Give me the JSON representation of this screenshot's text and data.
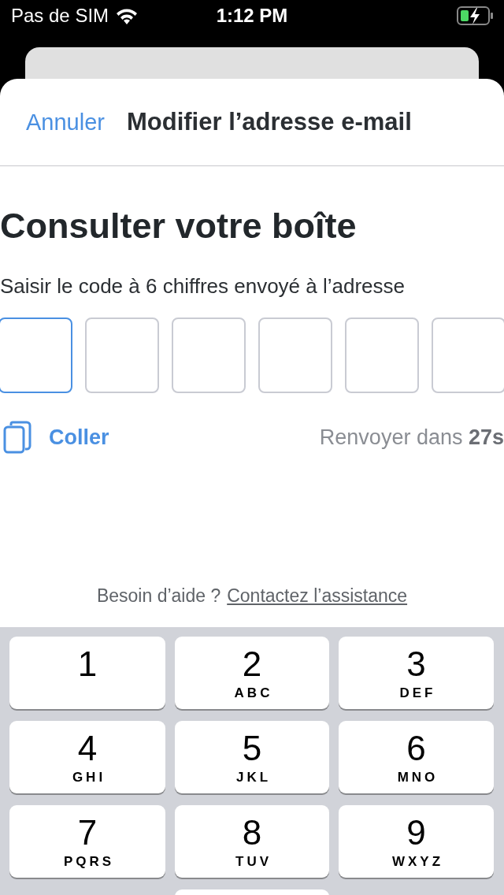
{
  "status_bar": {
    "carrier": "Pas de SIM",
    "time": "1:12 PM"
  },
  "header": {
    "cancel": "Annuler",
    "title": "Modifier l’adresse e-mail"
  },
  "heading": "Consulter votre boîte",
  "instructions": "Saisir le code à 6 chiffres envoyé à l’adresse",
  "code_boxes": [
    {
      "selected": true
    },
    {
      "selected": false
    },
    {
      "selected": false
    },
    {
      "selected": false
    },
    {
      "selected": false
    },
    {
      "selected": false
    }
  ],
  "paste": "Coller",
  "resend": "Renvoyer dans **27s**",
  "help": {
    "text": "Besoin d’aide ?",
    "link": "Contactez l’assistance"
  },
  "keypad": [
    {
      "kind": "digit",
      "digit": "1"
    },
    {
      "kind": "digit",
      "digit": "2",
      "letters": "ABC"
    },
    {
      "kind": "digit",
      "digit": "3",
      "letters": "DEF"
    },
    {
      "kind": "digit",
      "digit": "4",
      "letters": "GHI"
    },
    {
      "kind": "digit",
      "digit": "5",
      "letters": "JKL"
    },
    {
      "kind": "digit",
      "digit": "6",
      "letters": "MNO"
    },
    {
      "kind": "digit",
      "digit": "7",
      "letters": "PQRS"
    },
    {
      "kind": "digit",
      "digit": "8",
      "letters": "TUV"
    },
    {
      "kind": "digit",
      "digit": "9",
      "letters": "WXYZ"
    },
    {
      "kind": "empty"
    },
    {
      "kind": "blank"
    }
  ]
}
